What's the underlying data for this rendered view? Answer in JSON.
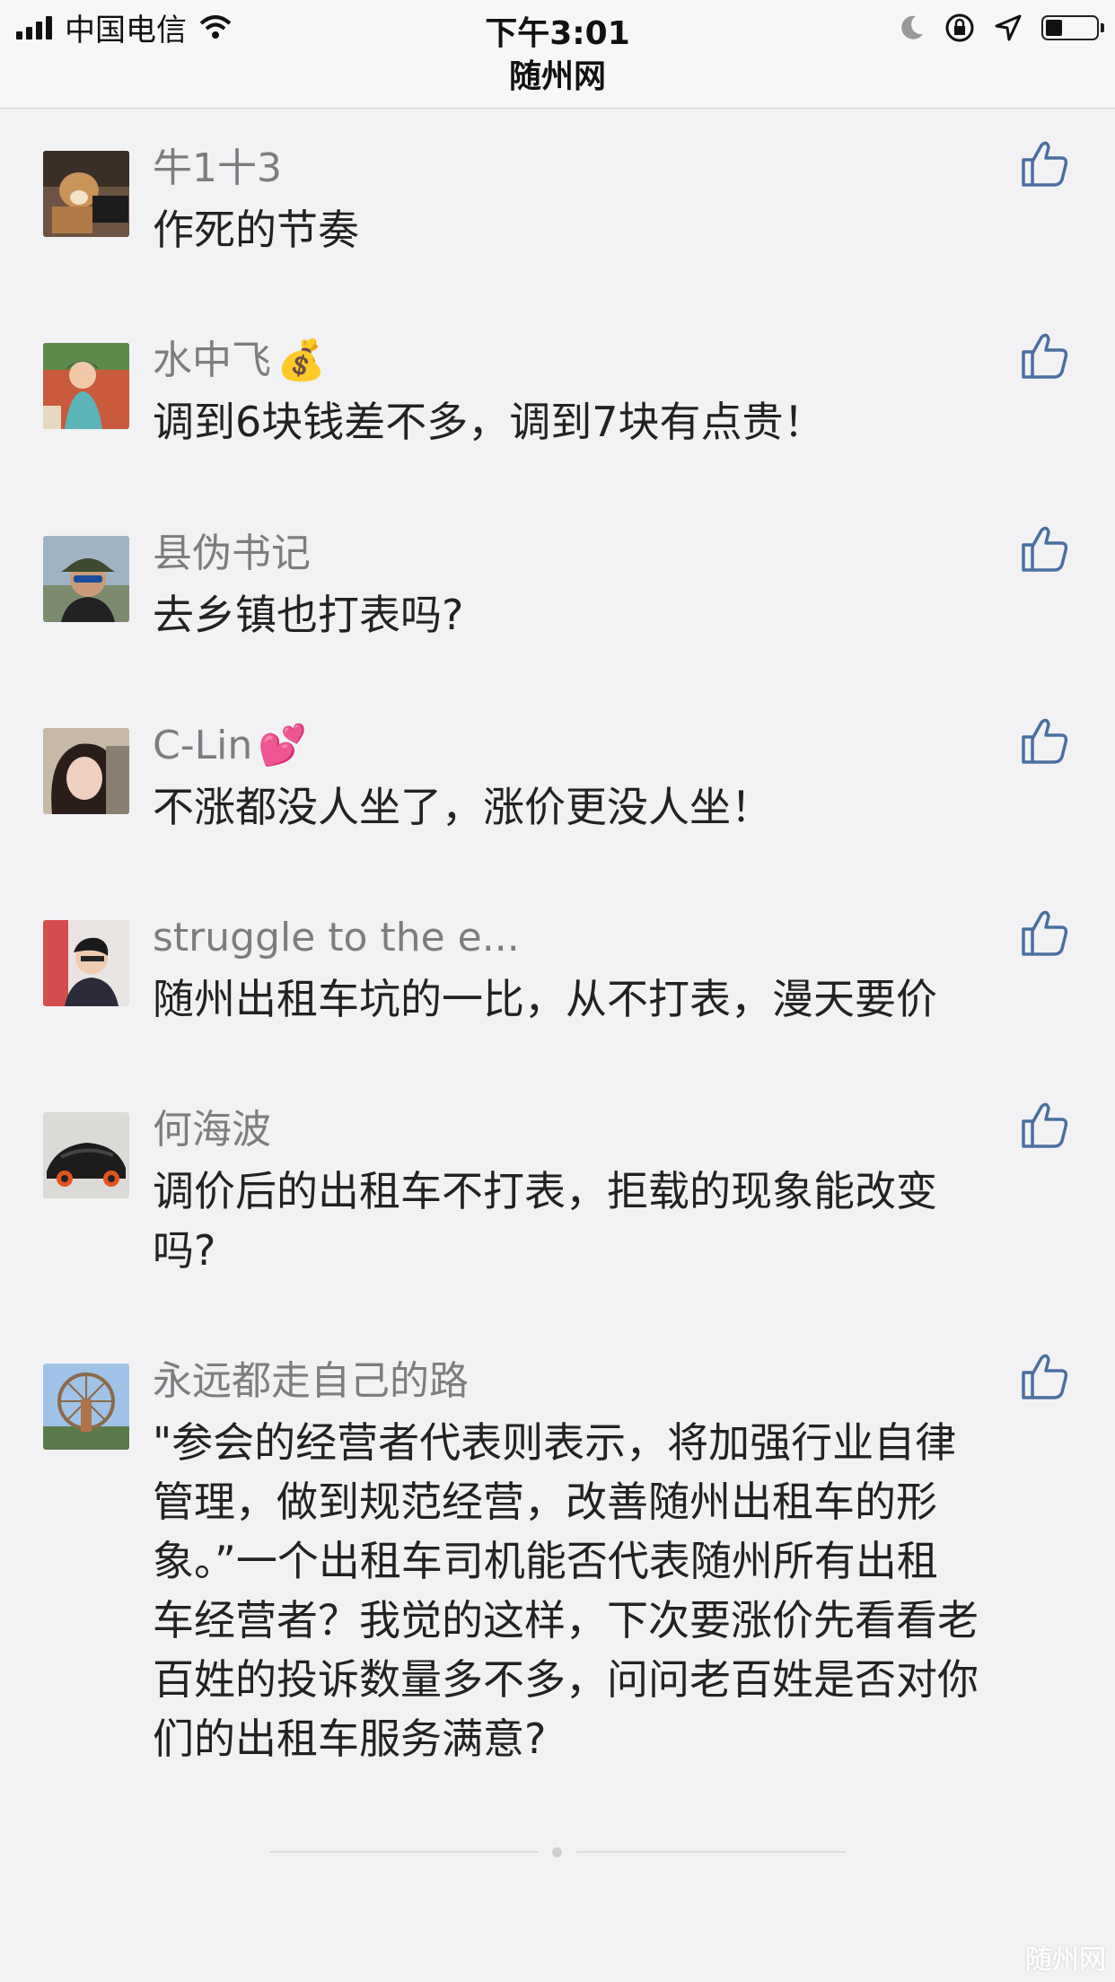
{
  "status_bar": {
    "carrier": "中国电信",
    "time": "下午3:01",
    "title": "随州网"
  },
  "comments": [
    {
      "name": "牛1十3",
      "emoji": "",
      "text": "作死的节奏"
    },
    {
      "name": "水中飞",
      "emoji": "💰",
      "text": "调到6块钱差不多，调到7块有点贵！"
    },
    {
      "name": "县伪书记",
      "emoji": "",
      "text": "去乡镇也打表吗?"
    },
    {
      "name": "C-Lin",
      "emoji": "💕",
      "text": "不涨都没人坐了，涨价更没人坐！"
    },
    {
      "name": "struggle to the e...",
      "emoji": "",
      "text": "随州出租车坑的一比，从不打表，漫天要价"
    },
    {
      "name": "何海波",
      "emoji": "",
      "text": "调价后的出租车不打表，拒载的现象能改变\n吗?"
    },
    {
      "name": "永远都走自己的路",
      "emoji": "",
      "text": "\"参会的经营者代表则表示，将加强行业自律\n管理，做到规范经营，改善随州出租车的形\n象。”一个出租车司机能否代表随州所有出租\n车经营者？我觉的这样，下次要涨价先看看老\n百姓的投诉数量多不多，问问老百姓是否对你\n们的出租车服务满意?"
    }
  ],
  "icons": {
    "like": "thumbs-up-icon",
    "signal": "signal-bars-icon",
    "wifi": "wifi-icon",
    "moon": "moon-icon",
    "rotation_lock": "rotation-lock-icon",
    "location": "location-arrow-icon",
    "battery": "battery-icon"
  },
  "watermark": "随州网",
  "colors": {
    "background": "#f2f2f4",
    "name": "#7d7d80",
    "text": "#222222",
    "like_icon": "#4a6fa0"
  }
}
